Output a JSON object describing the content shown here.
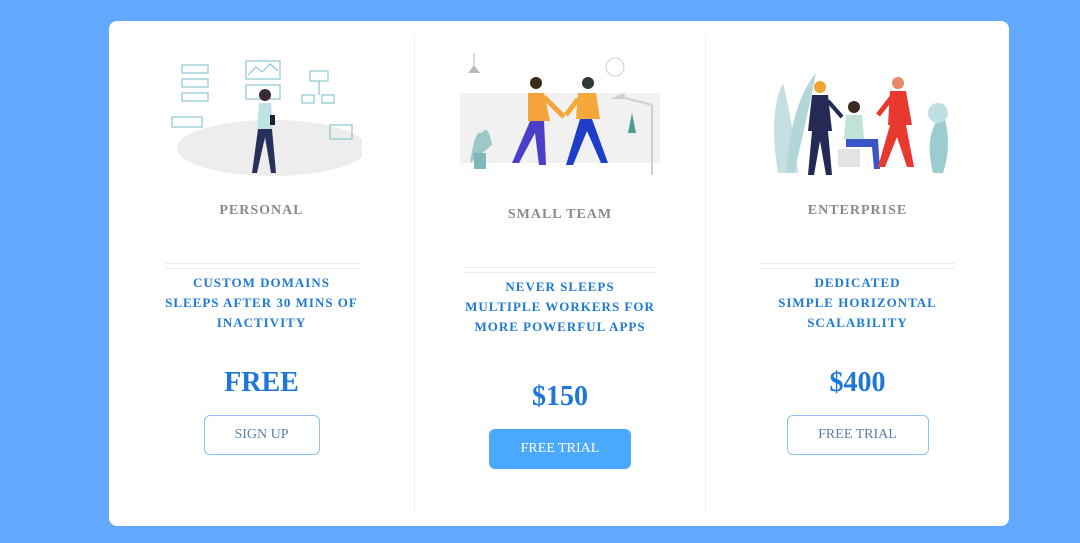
{
  "plans": [
    {
      "name": "PERSONAL",
      "features": [
        "CUSTOM DOMAINS",
        "SLEEPS AFTER 30 MINS OF INACTIVITY"
      ],
      "price": "FREE",
      "button": "SIGN UP",
      "illustration": "person-with-dashboard-illustration"
    },
    {
      "name": "SMALL TEAM",
      "features": [
        "NEVER SLEEPS",
        "MULTIPLE WORKERS FOR MORE POWERFUL APPS"
      ],
      "price": "$150",
      "button": "FREE TRIAL",
      "illustration": "two-people-walking-illustration"
    },
    {
      "name": "ENTERPRISE",
      "features": [
        "DEDICATED",
        "SIMPLE HORIZONTAL SCALABILITY"
      ],
      "price": "$400",
      "button": "FREE TRIAL",
      "illustration": "team-meeting-illustration"
    }
  ],
  "colors": {
    "background": "#62a9fd",
    "accent": "#1d76d8",
    "button_filled": "#4aa9fd"
  }
}
